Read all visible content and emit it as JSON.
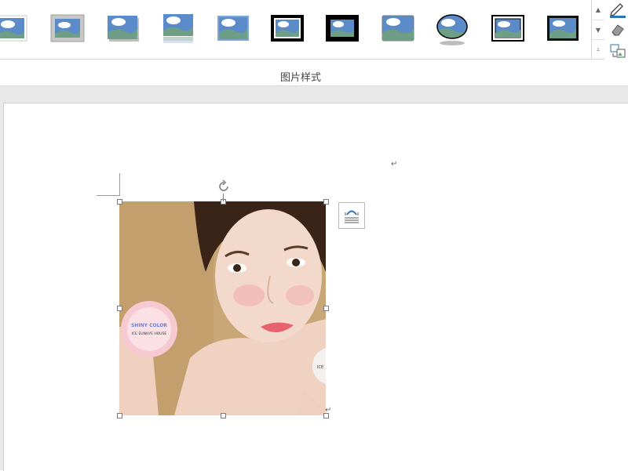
{
  "ribbon": {
    "group_label": "图片样式",
    "styles": [
      {
        "name": "simple-frame"
      },
      {
        "name": "beveled-matte"
      },
      {
        "name": "drop-shadow"
      },
      {
        "name": "reflected"
      },
      {
        "name": "soft-edge"
      },
      {
        "name": "thick-black-frame"
      },
      {
        "name": "black-matte"
      },
      {
        "name": "rounded-rectangle"
      },
      {
        "name": "oval-shadow"
      },
      {
        "name": "double-frame"
      },
      {
        "name": "thin-black-frame"
      }
    ]
  },
  "image": {
    "product_text": [
      "SHINY COLOR",
      "ICE EUNHYE HOUSE"
    ],
    "product_text_right": "ICE"
  },
  "colors": {
    "sky": "#5b8bc9",
    "hill": "#6e9f86",
    "cloud": "#ffffff",
    "accent": "#2e75b6"
  }
}
